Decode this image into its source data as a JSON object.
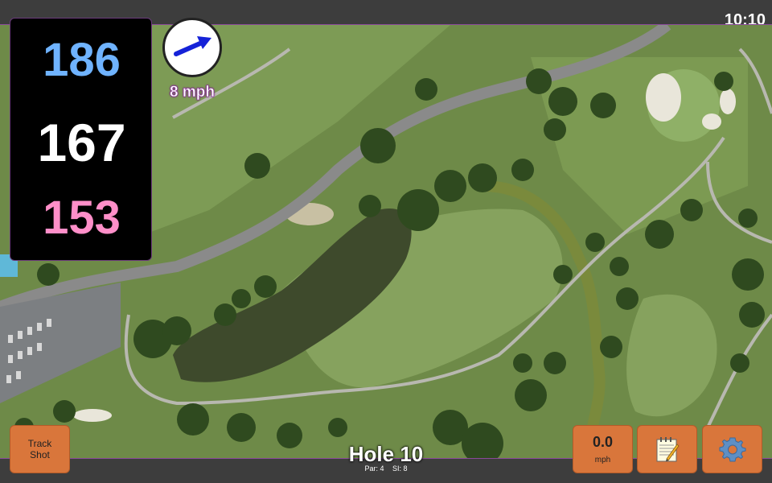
{
  "clock": "10:10",
  "distances": {
    "back": "186",
    "middle": "167",
    "front": "153"
  },
  "wind": {
    "speed": "8 mph",
    "direction_icon": "arrow-icon"
  },
  "buttons": {
    "track_shot": "Track Shot",
    "speed_value": "0.0",
    "speed_unit": "mph",
    "notes_icon": "notepad-icon",
    "settings_icon": "gear-icon"
  },
  "hole": {
    "title": "Hole 10",
    "par": "Par: 4",
    "si": "SI: 8"
  },
  "colors": {
    "back": "#6fb3ff",
    "middle": "#ffffff",
    "front": "#ff8fc9",
    "button": "#d9763b"
  }
}
